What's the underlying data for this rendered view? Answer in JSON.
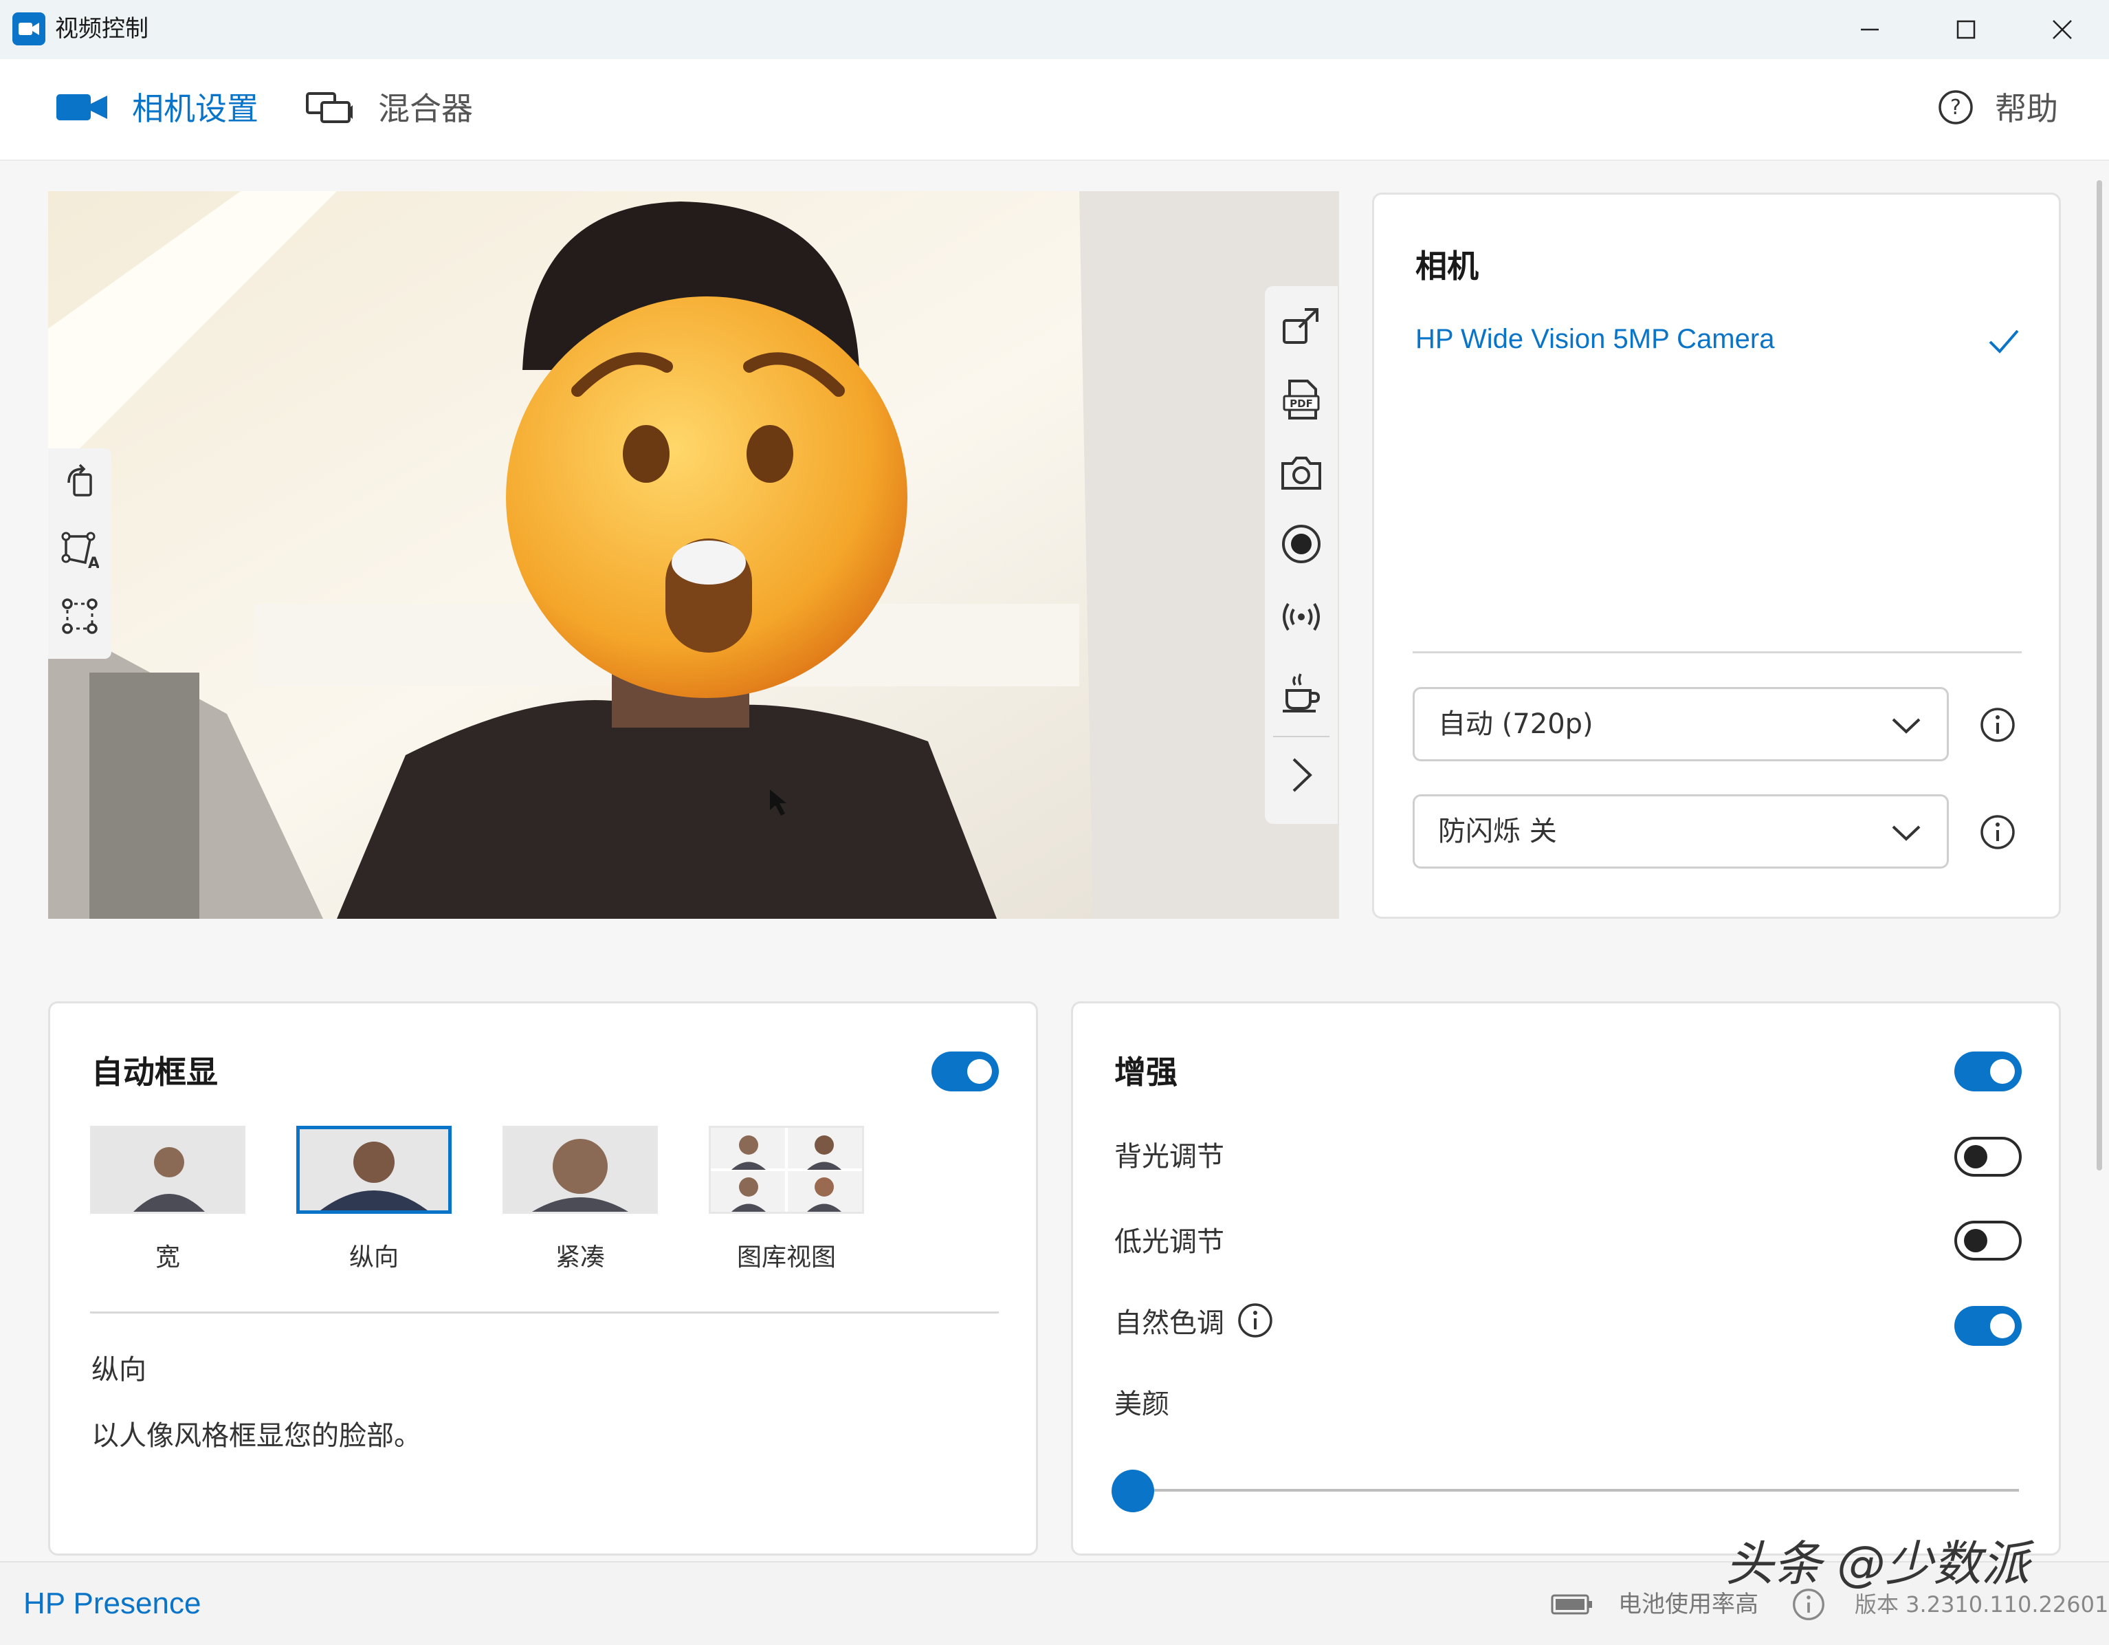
{
  "window": {
    "title": "视频控制",
    "minimize_glyph": "—",
    "maximize_glyph": "☐",
    "close_glyph": "✕"
  },
  "nav": {
    "camera_settings": "相机设置",
    "mixer": "混合器",
    "help": "帮助"
  },
  "camera_panel": {
    "heading": "相机",
    "selected_camera": "HP Wide Vision 5MP Camera",
    "resolution": "自动 (720p)",
    "flicker": "防闪烁 关"
  },
  "auto_frame": {
    "heading": "自动框显",
    "enabled": true,
    "options": [
      {
        "label": "宽",
        "selected": false
      },
      {
        "label": "纵向",
        "selected": true
      },
      {
        "label": "紧凑",
        "selected": false
      },
      {
        "label": "图库视图",
        "selected": false
      }
    ],
    "description_title": "纵向",
    "description": "以人像风格框显您的脸部。"
  },
  "enhance": {
    "heading": "增强",
    "enabled": true,
    "backlight": {
      "label": "背光调节",
      "enabled": false
    },
    "lowlight": {
      "label": "低光调节",
      "enabled": false
    },
    "natural_tone": {
      "label": "自然色调",
      "enabled": true
    },
    "beauty": {
      "label": "美颜",
      "value": 0
    }
  },
  "status": {
    "brand": "HP Presence",
    "battery": "电池使用率高",
    "version": "版本 3.2310.110.22601",
    "watermark": "头条 @少数派"
  },
  "colors": {
    "accent": "#0a74c9"
  }
}
